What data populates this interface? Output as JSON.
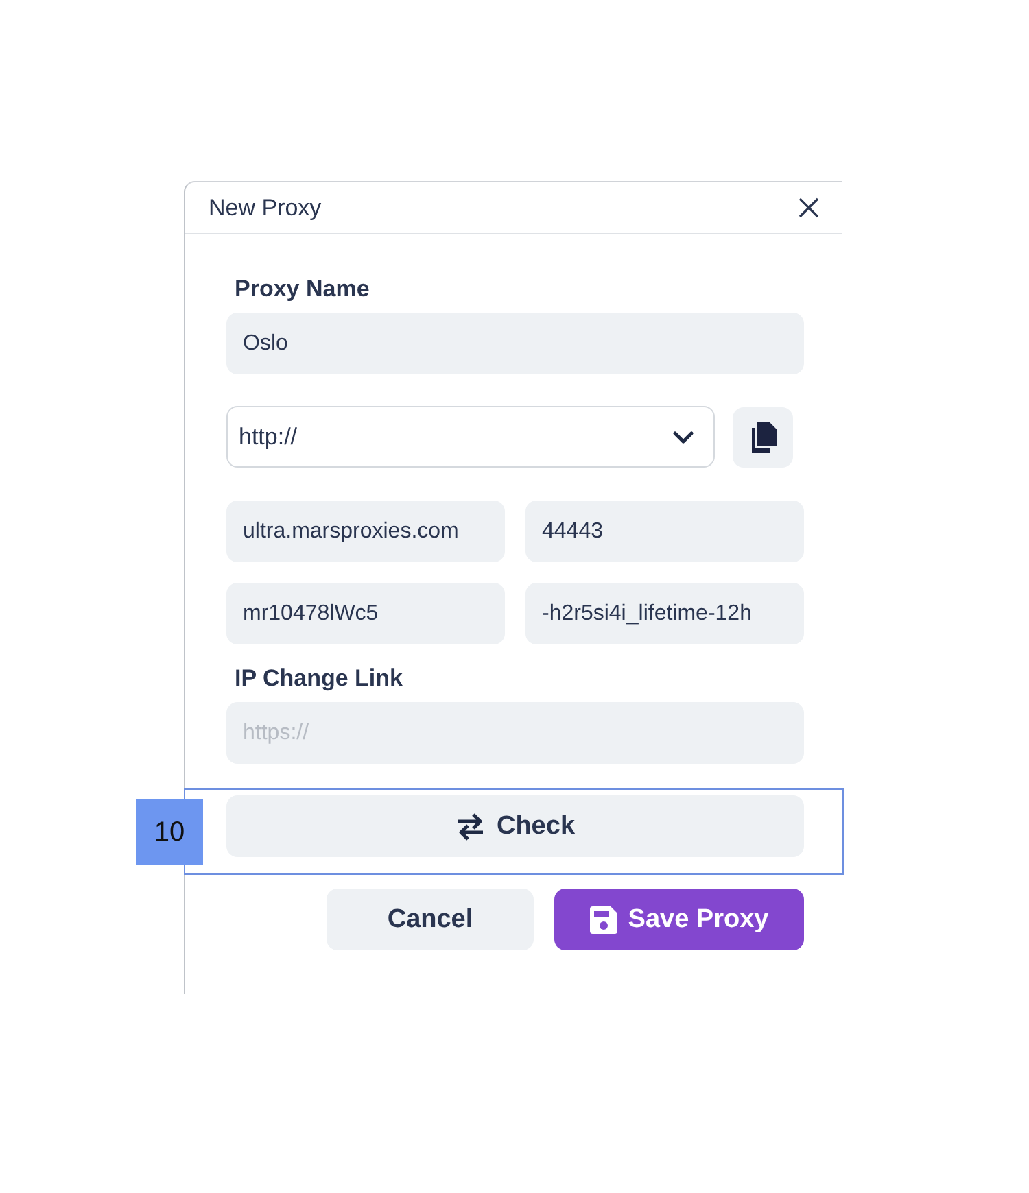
{
  "dialog": {
    "title": "New Proxy"
  },
  "proxy_name": {
    "label": "Proxy Name",
    "value": "Oslo"
  },
  "protocol": {
    "value": "http://"
  },
  "host": {
    "value": "ultra.marsproxies.com"
  },
  "port": {
    "value": "44443"
  },
  "username": {
    "value": "mr10478lWc5"
  },
  "password": {
    "value": "-h2r5si4i_lifetime-12h"
  },
  "ip_change_link": {
    "label": "IP Change Link",
    "placeholder": "https://"
  },
  "check_button": {
    "label": "Check"
  },
  "cancel_button": {
    "label": "Cancel"
  },
  "save_button": {
    "label": "Save Proxy"
  },
  "annotation": {
    "label": "10"
  }
}
